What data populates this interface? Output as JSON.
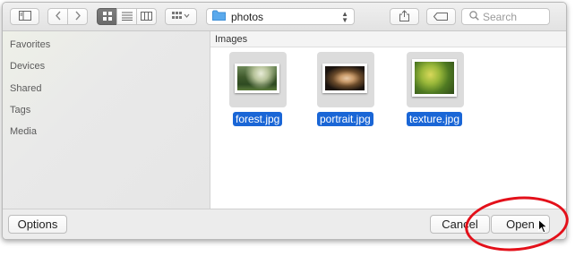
{
  "toolbar": {
    "sidebar_toggle_icon": "sidebar-icon",
    "back_icon": "chevron-left-icon",
    "forward_icon": "chevron-right-icon",
    "view_modes": [
      "icon-view-icon",
      "list-view-icon",
      "column-view-icon"
    ],
    "arrange_icon": "grid-arrange-icon",
    "path": {
      "folder_icon": "folder-icon",
      "label": "photos"
    },
    "share_icon": "share-icon",
    "tags_icon": "tag-icon",
    "search": {
      "placeholder": "Search",
      "icon": "search-icon"
    }
  },
  "sidebar": {
    "items": [
      "Favorites",
      "Devices",
      "Shared",
      "Tags",
      "Media"
    ]
  },
  "main": {
    "column_header": "Images",
    "files": [
      {
        "name": "forest.jpg"
      },
      {
        "name": "portrait.jpg"
      },
      {
        "name": "texture.jpg"
      }
    ]
  },
  "footer": {
    "options_label": "Options",
    "cancel_label": "Cancel",
    "open_label": "Open"
  },
  "colors": {
    "selection": "#1a66d6",
    "annotation_ring": "#e3101a",
    "folder": "#5aa9ec"
  }
}
